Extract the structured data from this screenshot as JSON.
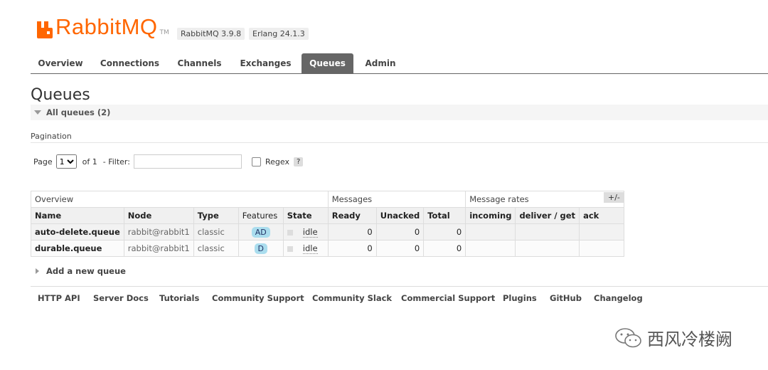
{
  "header": {
    "brand": "RabbitMQ",
    "tm": "TM",
    "versions": [
      "RabbitMQ 3.9.8",
      "Erlang 24.1.3"
    ]
  },
  "nav": {
    "tabs": [
      "Overview",
      "Connections",
      "Channels",
      "Exchanges",
      "Queues",
      "Admin"
    ],
    "active": "Queues"
  },
  "page": {
    "title": "Queues",
    "section": "All queues (2)"
  },
  "pagination": {
    "label": "Pagination",
    "page_label": "Page",
    "page_value": "1",
    "of_label": "of 1",
    "filter_label": "- Filter:",
    "filter_value": "",
    "regex_label": "Regex",
    "help": "?"
  },
  "table": {
    "groups": [
      "Overview",
      "Messages",
      "Message rates"
    ],
    "columns": [
      "Name",
      "Node",
      "Type",
      "Features",
      "State",
      "Ready",
      "Unacked",
      "Total",
      "incoming",
      "deliver / get",
      "ack"
    ],
    "toggle": "+/-",
    "rows": [
      {
        "name": "auto-delete.queue",
        "node": "rabbit@rabbit1",
        "type": "classic",
        "features": "AD",
        "state": "idle",
        "ready": "0",
        "unacked": "0",
        "total": "0"
      },
      {
        "name": "durable.queue",
        "node": "rabbit@rabbit1",
        "type": "classic",
        "features": "D",
        "state": "idle",
        "ready": "0",
        "unacked": "0",
        "total": "0"
      }
    ]
  },
  "add_queue": "Add a new queue",
  "footer": [
    "HTTP API",
    "Server Docs",
    "Tutorials",
    "Community Support",
    "Community Slack",
    "Commercial Support",
    "Plugins",
    "GitHub",
    "Changelog"
  ],
  "watermark": "西风冷楼阙",
  "colors": {
    "brand": "#ff6600",
    "active_tab": "#666666",
    "feature_badge": "#aaddee"
  }
}
